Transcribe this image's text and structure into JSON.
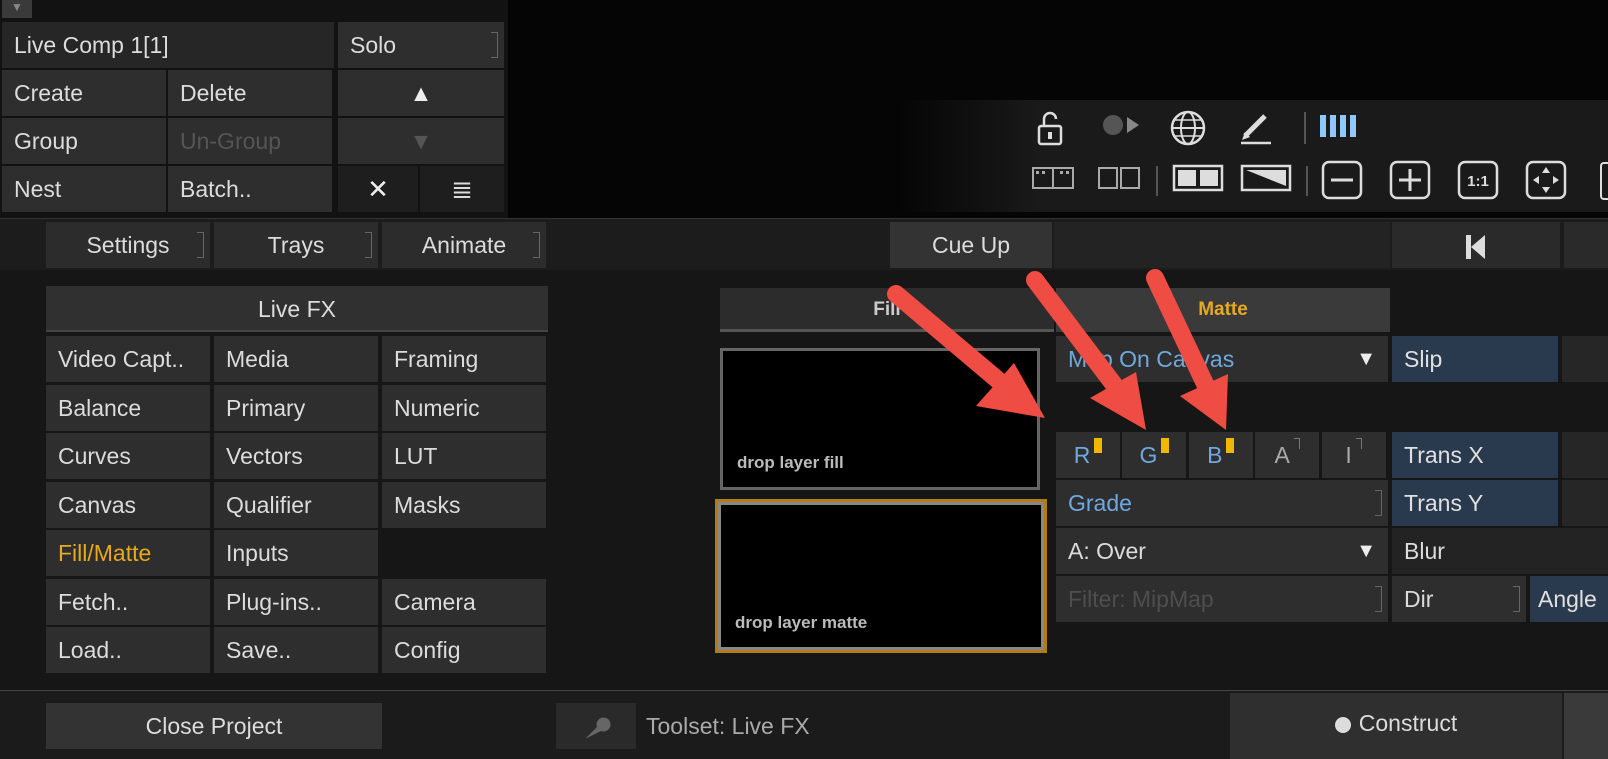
{
  "layer_panel": {
    "comp_name": "Live Comp 1[1]",
    "solo": "Solo",
    "create": "Create",
    "delete": "Delete",
    "up": "▲",
    "group": "Group",
    "ungroup": "Un-Group",
    "down": "▼",
    "nest": "Nest",
    "batch": "Batch..",
    "close_x": "✕",
    "list": "≣"
  },
  "toolbar": {
    "settings": "Settings",
    "trays": "Trays",
    "animate": "Animate",
    "cue_up": "Cue Up",
    "skip_start": "⏮"
  },
  "view_icons": {
    "row1": [
      "unlock-icon",
      "record-play-icon",
      "globe-icon",
      "pen-icon",
      "bars-icon"
    ],
    "row2": [
      "film-strip-icon",
      "split-film-icon",
      "dual-view-icon",
      "diagonal-icon",
      "zoom-out-icon",
      "zoom-in-icon",
      "one-to-one-icon",
      "fit-icon"
    ],
    "minus": "−",
    "plus": "+",
    "one_to_one": "1:1"
  },
  "livefx": {
    "header": "Live FX",
    "items": [
      [
        "Video Capt..",
        "Media",
        "Framing"
      ],
      [
        "Balance",
        "Primary",
        "Numeric"
      ],
      [
        "Curves",
        "Vectors",
        "LUT"
      ],
      [
        "Canvas",
        "Qualifier",
        "Masks"
      ],
      [
        "Fill/Matte",
        "Inputs",
        ""
      ],
      [
        "Fetch..",
        "Plug-ins..",
        "Camera"
      ],
      [
        "Load..",
        "Save..",
        "Config"
      ]
    ],
    "active": "Fill/Matte"
  },
  "fillmatte": {
    "tab_fill": "Fill",
    "tab_matte": "Matte",
    "drop_fill": "drop layer fill",
    "drop_matte": "drop layer matte",
    "mapping": "Map On Canvas",
    "slip": "Slip",
    "channels": [
      "R",
      "G",
      "B",
      "A",
      "I"
    ],
    "trans_x": "Trans X",
    "trans_y": "Trans Y",
    "grade": "Grade",
    "blend": "A: Over",
    "blur": "Blur",
    "filter": "Filter: MipMap",
    "dir": "Dir",
    "angle": "Angle"
  },
  "bottom": {
    "close_project": "Close Project",
    "toolset": "Toolset: Live FX",
    "construct": "Construct"
  },
  "colors": {
    "accent_orange": "#e8a81f",
    "link_blue": "#6fa8e0",
    "annotation_red": "#ef4c43"
  }
}
